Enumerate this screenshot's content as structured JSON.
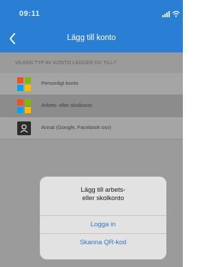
{
  "status_bar": {
    "time": "09:11",
    "icons": [
      "signal-icon",
      "wifi-icon"
    ]
  },
  "nav": {
    "back_icon": "chevron-left-icon",
    "title": "Lägg till konto"
  },
  "section": {
    "header": "VILKEN TYP AV KONTO LÄGGER DU TILL?"
  },
  "accounts": [
    {
      "label": "Personligt konto",
      "icon": "microsoft-logo-icon",
      "selected": false
    },
    {
      "label": "Arbets- eller skolkonto",
      "icon": "microsoft-logo-icon",
      "selected": true
    },
    {
      "label": "Annat (Google, Facebook osv)",
      "icon": "person-icon",
      "selected": false
    }
  ],
  "dialog": {
    "title_line1": "Lägg till arbets-",
    "title_line2": "eller skolkonto",
    "login_label": "Logga in",
    "qr_label": "Skanna QR-kod"
  },
  "colors": {
    "header_bg": "#2a7fd4",
    "overlay_bg": "#9b9b9b",
    "dialog_bg": "#e2e2e2",
    "link_blue": "#2f74c9",
    "ms_red": "#f25022",
    "ms_green": "#7fba00",
    "ms_blue": "#00a4ef",
    "ms_yellow": "#ffb900"
  }
}
